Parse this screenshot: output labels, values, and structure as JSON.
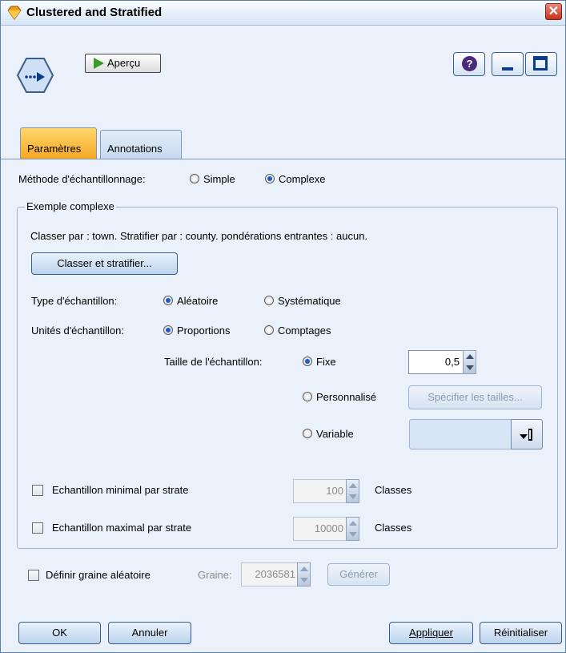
{
  "window": {
    "title": "Clustered and Stratified",
    "close_glyph": "✕"
  },
  "toolbar": {
    "preview_label": "Aperçu",
    "help_glyph": "?"
  },
  "tabs": [
    {
      "label": "Paramètres",
      "active": true
    },
    {
      "label": "Annotations",
      "active": false
    }
  ],
  "sampling_method": {
    "label": "Méthode d'échantillonnage:",
    "options": [
      "Simple",
      "Complexe"
    ],
    "selected": "Complexe"
  },
  "complex": {
    "group_title": "Exemple complexe",
    "summary": "Classer par : town. Stratifier par : county. pondérations entrantes : aucun.",
    "cluster_button": "Classer et stratifier...",
    "sample_type": {
      "label": "Type d'échantillon:",
      "options": [
        "Aléatoire",
        "Systématique"
      ],
      "selected": "Aléatoire"
    },
    "sample_units": {
      "label": "Unités d'échantillon:",
      "options": [
        "Proportions",
        "Comptages"
      ],
      "selected": "Proportions"
    },
    "sample_size": {
      "label": "Taille de l'échantillon:",
      "fixed_label": "Fixe",
      "fixed_value": "0,5",
      "custom_label": "Personnalisé",
      "custom_button": "Spécifier les tailles...",
      "variable_label": "Variable",
      "selected": "Fixe"
    },
    "min_per_stratum": {
      "label": "Echantillon minimal par strate",
      "value": "100",
      "unit": "Classes",
      "checked": false
    },
    "max_per_stratum": {
      "label": "Echantillon maximal par strate",
      "value": "10000",
      "unit": "Classes",
      "checked": false
    }
  },
  "random_seed": {
    "label": "Définir graine aléatoire",
    "seed_label": "Graine:",
    "seed_value": "2036581",
    "generate_button": "Générer",
    "checked": false
  },
  "footer": {
    "ok": "OK",
    "cancel": "Annuler",
    "apply": "Appliquer",
    "reset": "Réinitialiser"
  },
  "colors": {
    "background": "#eaf1fb",
    "active_tab": "#f6a623",
    "button": "#bcd3ee"
  }
}
